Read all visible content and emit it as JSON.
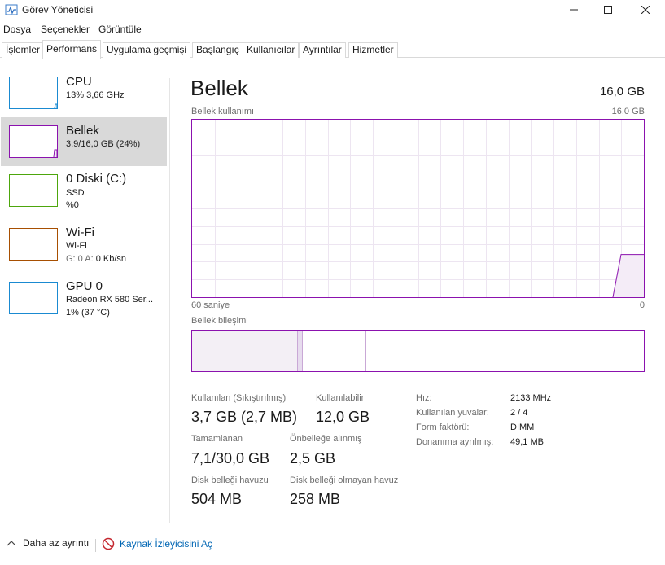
{
  "window": {
    "title": "Görev Yöneticisi"
  },
  "menu": [
    "Dosya",
    "Seçenekler",
    "Görüntüle"
  ],
  "tabs": [
    "İşlemler",
    "Performans",
    "Uygulama geçmişi",
    "Başlangıç",
    "Kullanıcılar",
    "Ayrıntılar",
    "Hizmetler"
  ],
  "active_tab": "Performans",
  "sidebar": {
    "items": [
      {
        "title": "CPU",
        "line1": "13% 3,66 GHz",
        "line2": "",
        "color": "#1a8ad1",
        "usage_percent": 13
      },
      {
        "title": "Bellek",
        "line1": "3,9/16,0 GB (24%)",
        "line2": "",
        "color": "#8b12ae",
        "usage_percent": 24
      },
      {
        "title": "0 Diski (C:)",
        "line1": "SSD",
        "line2": "%0",
        "color": "#4da60c",
        "usage_percent": 0
      },
      {
        "title": "Wi-Fi",
        "line1": "Wi-Fi",
        "line2_label": "G: 0 A: ",
        "line2_value": "0 Kb/sn",
        "color": "#a74f01"
      },
      {
        "title": "GPU 0",
        "line1": "Radeon RX 580 Ser...",
        "line2": "1% (37 °C)",
        "color": "#1a8ad1",
        "usage_percent": 1
      }
    ]
  },
  "main": {
    "title": "Bellek",
    "total": "16,0 GB",
    "usage_label": "Bellek kullanımı",
    "usage_max": "16,0 GB",
    "time_left": "60 saniye",
    "time_right": "0",
    "composition_label": "Bellek bileşimi",
    "accent": "#8b12ae"
  },
  "composition": {
    "in_use_fraction": 0.235,
    "modified_fraction": 0.01,
    "standby_fraction": 0.14,
    "free_fraction": 0.615
  },
  "stats": {
    "in_use_label": "Kullanılan (Sıkıştırılmış)",
    "in_use_value": "3,7 GB (2,7 MB)",
    "available_label": "Kullanılabilir",
    "available_value": "12,0 GB",
    "committed_label": "Tamamlanan",
    "committed_value": "7,1/30,0 GB",
    "cached_label": "Önbelleğe alınmış",
    "cached_value": "2,5 GB",
    "paged_label": "Disk belleği havuzu",
    "paged_value": "504 MB",
    "nonpaged_label": "Disk belleği olmayan havuz",
    "nonpaged_value": "258 MB"
  },
  "details": [
    {
      "key": "Hız:",
      "value": "2133 MHz"
    },
    {
      "key": "Kullanılan yuvalar:",
      "value": "2 / 4"
    },
    {
      "key": "Form faktörü:",
      "value": "DIMM"
    },
    {
      "key": "Donanıma ayrılmış:",
      "value": "49,1 MB"
    }
  ],
  "footer": {
    "less_details": "Daha az ayrıntı",
    "resource_monitor": "Kaynak İzleyicisini Aç"
  }
}
